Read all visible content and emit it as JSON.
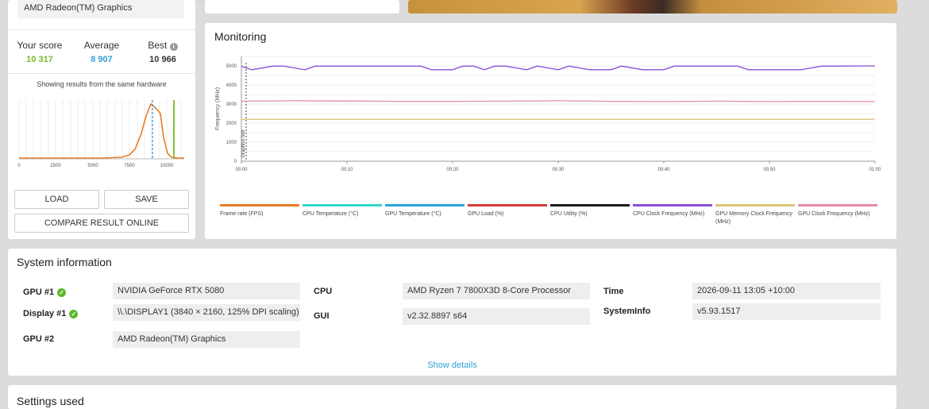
{
  "left_panel": {
    "gpu_selected": "AMD Radeon(TM) Graphics",
    "scores": [
      {
        "label": "Your score",
        "value": "10 317",
        "color": "#7ab929"
      },
      {
        "label": "Average",
        "value": "8 907",
        "color": "#2ea3d6"
      },
      {
        "label": "Best",
        "value": "10 966",
        "color": "#333333"
      }
    ],
    "showing_results": "Showing results from the same hardware",
    "histogram_ticks": [
      "0",
      "2500",
      "5000",
      "7500",
      "10000"
    ],
    "load_label": "LOAD",
    "save_label": "SAVE",
    "compare_label": "COMPARE RESULT ONLINE"
  },
  "monitoring": {
    "title": "Monitoring",
    "ylabel": "Frequency (MHz)",
    "marker_label": "Graphics test",
    "legend": [
      {
        "label": "Frame rate (FPS)",
        "color": "#e87d26"
      },
      {
        "label": "CPU Temperature (°C)",
        "color": "#2fd9c7"
      },
      {
        "label": "GPU Temperature (°C)",
        "color": "#2aa6e0"
      },
      {
        "label": "GPU Load (%)",
        "color": "#d23a3a"
      },
      {
        "label": "CPU Utility (%)",
        "color": "#1a1a1a"
      },
      {
        "label": "CPU Clock Frequency (MHz)",
        "color": "#8b4fd6"
      },
      {
        "label": "GPU Memory Clock Frequency (MHz)",
        "color": "#dcc67a"
      },
      {
        "label": "GPU Clock Frequency (MHz)",
        "color": "#e28bab"
      }
    ]
  },
  "chart_data": {
    "type": "line",
    "x_ticks": [
      "00:00",
      "00:10",
      "00:20",
      "00:30",
      "00:40",
      "00:50",
      "01:00"
    ],
    "y_ticks": [
      "0",
      "1000",
      "2000",
      "3000",
      "4000",
      "5000"
    ],
    "ylabel": "Frequency (MHz)",
    "ylim": [
      0,
      5500
    ],
    "series": [
      {
        "name": "CPU Clock Frequency (MHz)",
        "color": "#8b4fd6",
        "x": [
          0,
          1,
          3,
          4,
          6,
          7,
          8,
          10,
          12,
          13,
          15,
          17,
          18,
          20,
          21,
          22,
          23,
          24,
          25,
          27,
          28,
          30,
          31,
          33,
          35,
          36,
          38,
          40,
          41,
          43,
          45,
          47,
          48,
          50,
          53,
          55,
          57,
          60
        ],
        "values": [
          4980,
          4800,
          4990,
          4990,
          4800,
          4990,
          4990,
          4990,
          4990,
          4990,
          4990,
          4990,
          4800,
          4800,
          4990,
          4990,
          4800,
          4990,
          4990,
          4800,
          4990,
          4800,
          4990,
          4800,
          4800,
          4990,
          4800,
          4800,
          4990,
          4990,
          4990,
          4990,
          4800,
          4800,
          4800,
          4990,
          4990,
          5000
        ]
      },
      {
        "name": "GPU Clock Frequency (MHz)",
        "color": "#e28bab",
        "x": [
          0,
          5,
          10,
          15,
          20,
          25,
          30,
          35,
          40,
          45,
          50,
          55,
          60
        ],
        "values": [
          3150,
          3170,
          3160,
          3140,
          3140,
          3150,
          3170,
          3140,
          3130,
          3150,
          3130,
          3140,
          3130
        ]
      },
      {
        "name": "GPU Memory Clock Frequency (MHz)",
        "color": "#dcc67a",
        "x": [
          0,
          60
        ],
        "values": [
          2200,
          2200
        ]
      }
    ]
  },
  "system_info": {
    "title": "System information",
    "rows": [
      {
        "label": "GPU #1",
        "value": "NVIDIA GeForce RTX 5080"
      },
      {
        "label": "Display #1",
        "value": "\\\\.\\DISPLAY1 (3840 × 2160, 125% DPI scaling)"
      },
      {
        "label": "GPU #2",
        "value": "AMD Radeon(TM) Graphics"
      },
      {
        "label": "CPU",
        "value": "AMD Ryzen 7 7800X3D 8-Core Processor"
      },
      {
        "label": "GUI",
        "value": "v2.32.8897 s64"
      },
      {
        "label": "Time",
        "value": "2026-09-11 13:05 +10:00"
      },
      {
        "label": "SystemInfo",
        "value": "v5.93.1517"
      }
    ],
    "show_details": "Show details"
  },
  "settings": {
    "title": "Settings used"
  }
}
